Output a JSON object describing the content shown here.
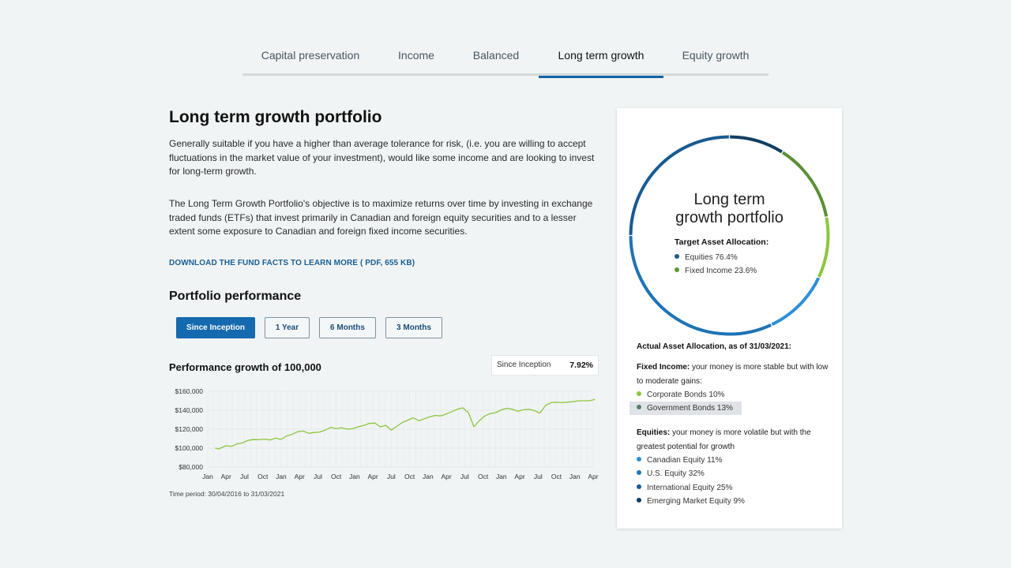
{
  "tabs": [
    {
      "label": "Capital preservation",
      "active": false
    },
    {
      "label": "Income",
      "active": false
    },
    {
      "label": "Balanced",
      "active": false
    },
    {
      "label": "Long term growth",
      "active": true
    },
    {
      "label": "Equity growth",
      "active": false
    }
  ],
  "portfolio": {
    "title": "Long term growth portfolio",
    "description_1": "Generally suitable if you have a higher than average tolerance for risk, (i.e. you are willing to accept fluctuations in the market value of your investment), would like some income and are looking to invest for long-term growth.",
    "description_2": "The Long Term Growth Portfolio's objective is to maximize returns over time by investing in exchange traded funds (ETFs) that invest primarily in Canadian and foreign equity securities and to a lesser extent some exposure to Canadian and foreign fixed income securities.",
    "download_link": "DOWNLOAD THE FUND FACTS TO LEARN MORE ( PDF, 655 KB)"
  },
  "performance": {
    "title": "Portfolio performance",
    "periods": [
      {
        "label": "Since Inception",
        "active": true
      },
      {
        "label": "1 Year",
        "active": false
      },
      {
        "label": "6 Months",
        "active": false
      },
      {
        "label": "3 Months",
        "active": false
      }
    ],
    "chart_title": "Performance growth of 100,000",
    "summary_label": "Since Inception",
    "summary_value": "7.92%",
    "time_period": "Time period: 30/04/2016 to 31/03/2021"
  },
  "chart_data": {
    "type": "line",
    "title": "Performance growth of 100,000",
    "x_ticks": [
      "Jan",
      "Apr",
      "Jul",
      "Oct",
      "Jan",
      "Apr",
      "Jul",
      "Oct",
      "Jan",
      "Apr",
      "Jul",
      "Oct",
      "Jan",
      "Apr",
      "Jul",
      "Oct",
      "Jan",
      "Apr",
      "Jul",
      "Oct",
      "Jan",
      "Apr"
    ],
    "y_ticks": [
      "$80,000",
      "$100,000",
      "$120,000",
      "$140,000",
      "$160,000"
    ],
    "ylim": [
      80000,
      160000
    ],
    "grid": true,
    "series": [
      {
        "color": "#8cc63f",
        "x": [
          0.4,
          0.6,
          1.0,
          1.3,
          1.6,
          1.9,
          2.2,
          2.5,
          2.8,
          3.1,
          3.4,
          3.7,
          4.0,
          4.3,
          4.6,
          4.9,
          5.2,
          5.5,
          5.8,
          6.1,
          6.4,
          6.7,
          7.0,
          7.3,
          7.6,
          7.9,
          8.2,
          8.5,
          8.8,
          9.1,
          9.4,
          9.7,
          10.0,
          10.3,
          10.6,
          10.9,
          11.2,
          11.5,
          11.8,
          12.1,
          12.4,
          12.7,
          13.0,
          13.3,
          13.6,
          13.9,
          14.2,
          14.5,
          14.8,
          15.1,
          15.4,
          15.7,
          16.0,
          16.3,
          16.6,
          16.9,
          17.2,
          17.5,
          17.8,
          18.1,
          18.4,
          18.7,
          19.0,
          19.3,
          19.6,
          19.9,
          20.2,
          20.5,
          20.8,
          21.1
        ],
        "values": [
          100000,
          99200,
          102500,
          101800,
          104500,
          105500,
          108200,
          109000,
          108800,
          109500,
          108600,
          110500,
          109200,
          112800,
          114500,
          117300,
          118000,
          115600,
          116500,
          117000,
          119000,
          121800,
          120500,
          121500,
          120000,
          120500,
          122500,
          124000,
          126000,
          126500,
          122500,
          124000,
          119000,
          123000,
          127000,
          129500,
          132000,
          128800,
          131000,
          133000,
          134500,
          134000,
          136000,
          138500,
          141000,
          142500,
          137500,
          122500,
          129000,
          134000,
          136500,
          137500,
          140500,
          142000,
          141000,
          139000,
          140500,
          141000,
          139500,
          137000,
          145000,
          148000,
          148500,
          148000,
          148500,
          149000,
          150000,
          150000,
          150000,
          151500
        ]
      }
    ]
  },
  "allocation": {
    "donut_title_line1": "Long term",
    "donut_title_line2": "growth portfolio",
    "target_title": "Target Asset Allocation:",
    "target_items": [
      {
        "label": "Equities 76.4%",
        "color": "#1c5a87"
      },
      {
        "label": "Fixed Income 23.6%",
        "color": "#5b9a32"
      }
    ],
    "actual_title": "Actual Asset Allocation, as of 31/03/2021:",
    "fixed_income_bold": "Fixed Income:",
    "fixed_income_desc": " your money is more stable but with low to moderate gains:",
    "fixed_items": [
      {
        "label": "Corporate Bonds 10%",
        "color": "#8cc63f",
        "value": 10
      },
      {
        "label": "Government Bonds 13%",
        "color": "#5a7f6e",
        "value": 13,
        "highlighted": true
      }
    ],
    "equities_bold": "Equities:",
    "equities_desc": " your money is more volatile but with the greatest potential for growth",
    "equity_items": [
      {
        "label": "Canadian Equity 11%",
        "color": "#2d8fd8",
        "value": 11
      },
      {
        "label": "U.S. Equity 32%",
        "color": "#1e73b4",
        "value": 32
      },
      {
        "label": "International Equity 25%",
        "color": "#175a92",
        "value": 25
      },
      {
        "label": "Emerging Market Equity 9%",
        "color": "#113f62",
        "value": 9
      }
    ],
    "ring_segments": [
      {
        "value": 9,
        "color": "#123f63"
      },
      {
        "value": 13,
        "color": "#5b8f35"
      },
      {
        "value": 10,
        "color": "#8cc63f"
      },
      {
        "value": 11,
        "color": "#2d8fd8"
      },
      {
        "value": 32,
        "color": "#1e73b4"
      },
      {
        "value": 25,
        "color": "#175a92"
      }
    ]
  }
}
